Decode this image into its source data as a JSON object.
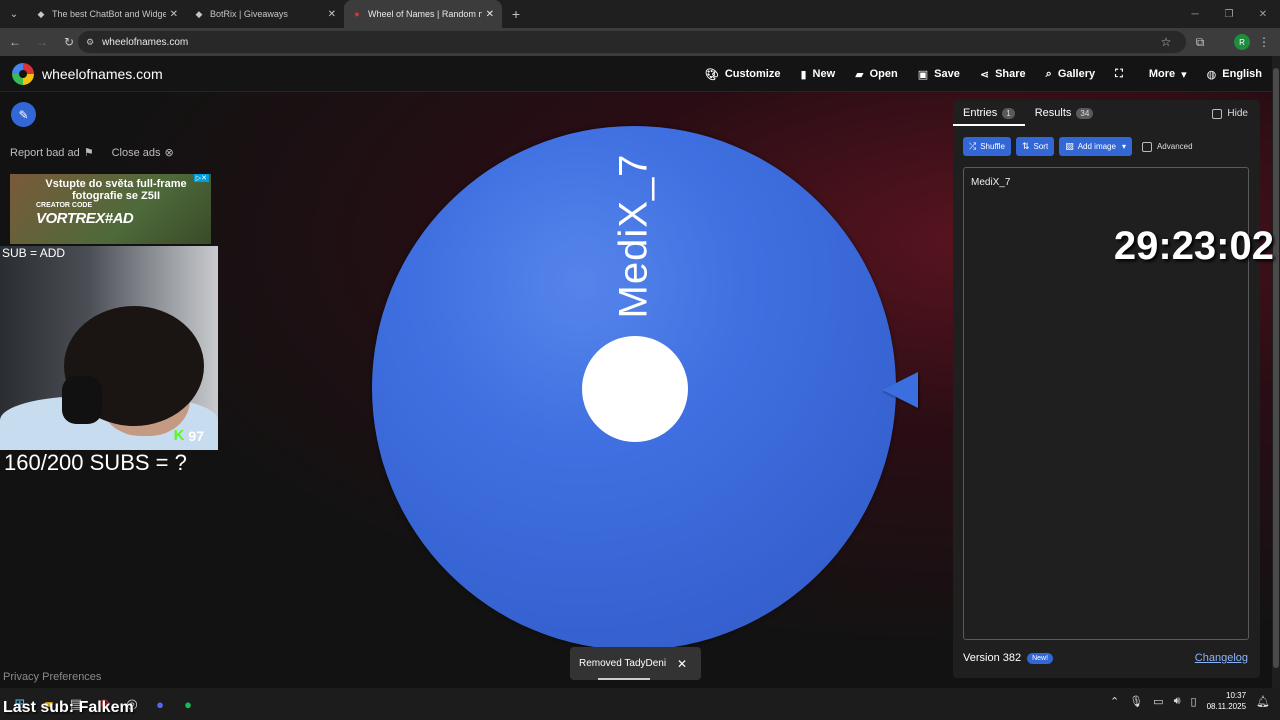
{
  "browser": {
    "tabs": [
      {
        "label": "The best ChatBot and Widgets",
        "active": false
      },
      {
        "label": "BotRix | Giveaways",
        "active": false
      },
      {
        "label": "Wheel of Names | Random nam",
        "active": true
      }
    ],
    "url": "wheelofnames.com"
  },
  "site": {
    "logo": "wheelofnames.com",
    "nav": {
      "customize": "Customize",
      "new": "New",
      "open": "Open",
      "save": "Save",
      "share": "Share",
      "gallery": "Gallery",
      "more": "More",
      "language": "English"
    }
  },
  "left": {
    "report_ad": "Report bad ad",
    "close_ads": "Close ads",
    "ad_headline": "Vstupte do světa full-frame fotografie se Z5II",
    "ad_creator": "CREATOR CODE",
    "ad_code": "VORTREX#AD",
    "overlay_sub_add": "SUB = ADD",
    "kick_viewers": "97",
    "subs_goal": "160/200 SUBS = ?",
    "privacy": "Privacy Preferences",
    "last_sub": "Last sub: Falkem"
  },
  "wheel": {
    "entry_label": "MediX_7",
    "color": "#3f6fe0"
  },
  "panel": {
    "tab_entries": "Entries",
    "entries_count": "1",
    "tab_results": "Results",
    "results_count": "34",
    "hide": "Hide",
    "shuffle": "Shuffle",
    "sort": "Sort",
    "add_image": "Add image",
    "advanced": "Advanced",
    "entries_text": "MediX_7",
    "timer": "29:23:02",
    "version": "Version 382",
    "new_badge": "New!",
    "changelog": "Changelog"
  },
  "toast": {
    "message": "Removed TadyDeni"
  },
  "taskbar": {
    "time": "10:37",
    "date": "08.11.2025"
  }
}
